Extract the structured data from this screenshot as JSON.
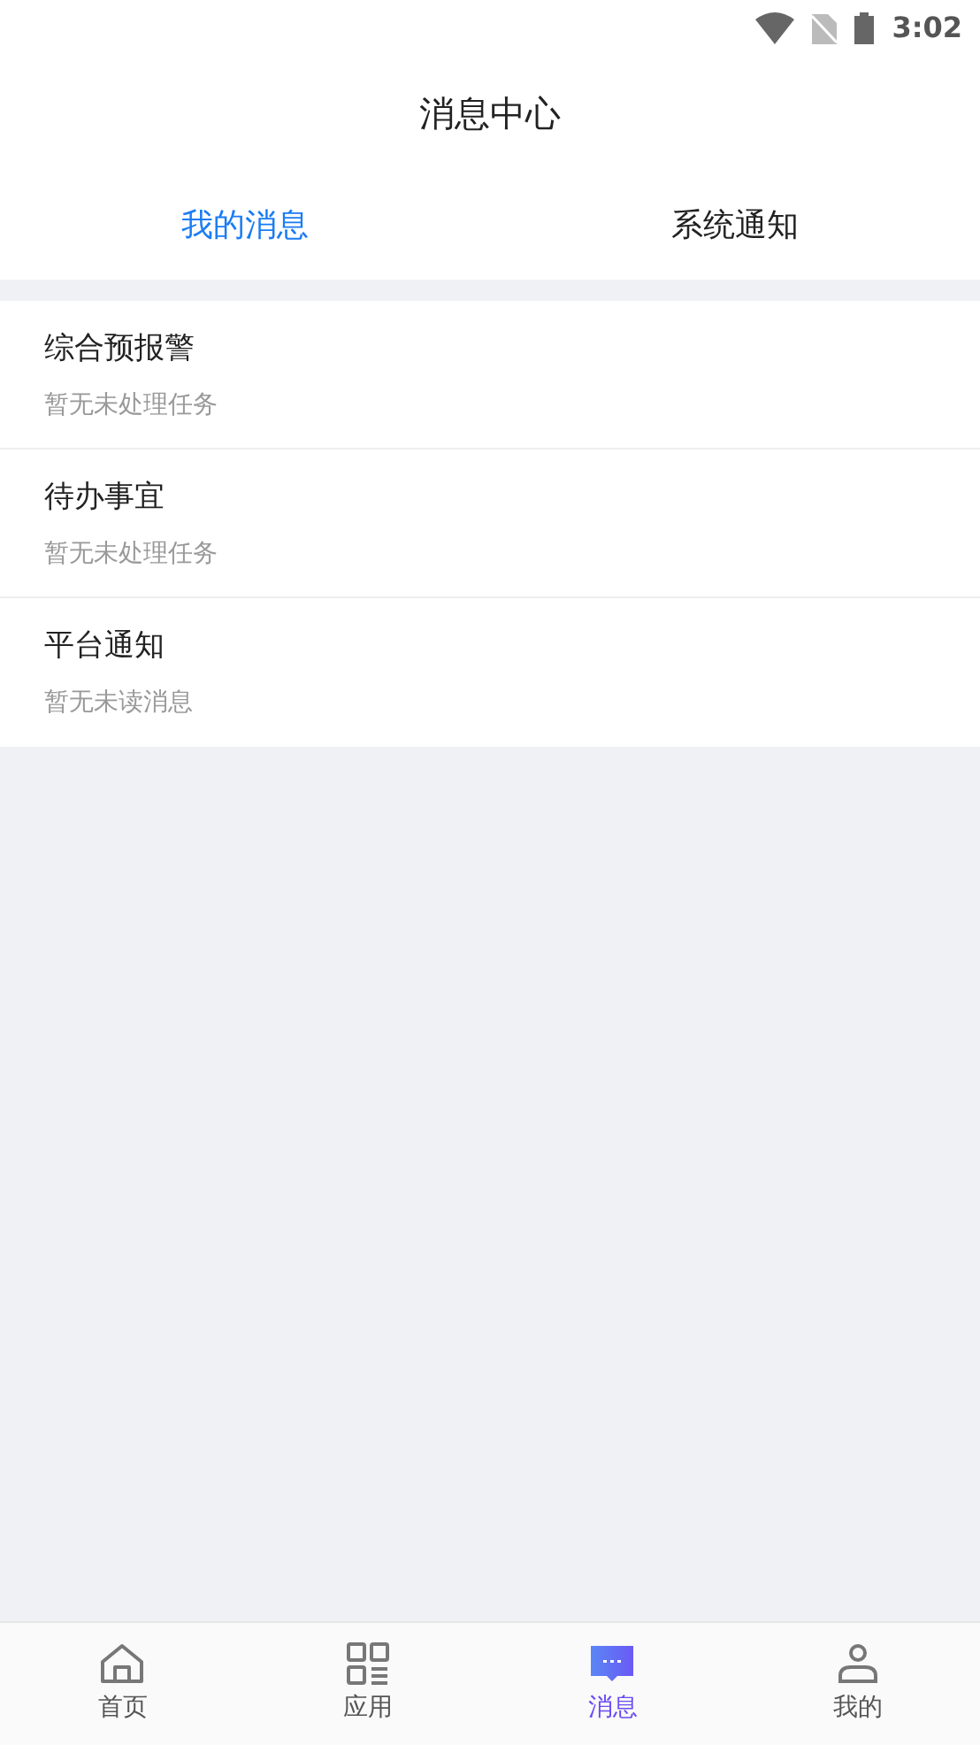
{
  "status_bar": {
    "time": "3:02"
  },
  "header": {
    "title": "消息中心"
  },
  "tabs": [
    {
      "label": "我的消息",
      "selected": true
    },
    {
      "label": "系统通知",
      "selected": false
    }
  ],
  "messages": [
    {
      "title": "综合预报警",
      "subtitle": "暂无未处理任务"
    },
    {
      "title": "待办事宜",
      "subtitle": "暂无未处理任务"
    },
    {
      "title": "平台通知",
      "subtitle": "暂无未读消息"
    }
  ],
  "bottom_nav": [
    {
      "kind": "home",
      "label": "首页",
      "selected": false
    },
    {
      "kind": "apps",
      "label": "应用",
      "selected": false
    },
    {
      "kind": "messages",
      "label": "消息",
      "selected": true
    },
    {
      "kind": "profile",
      "label": "我的",
      "selected": false
    }
  ]
}
